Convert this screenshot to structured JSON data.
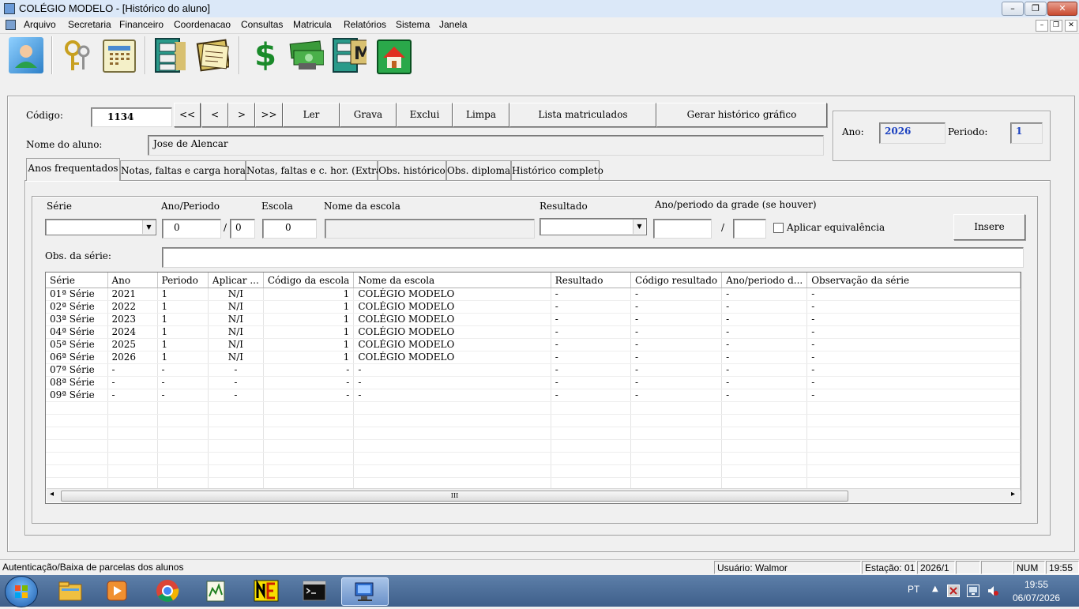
{
  "window": {
    "title": "COLÉGIO MODELO - [Histórico do aluno]",
    "min": "–",
    "max": "❐",
    "close": "✕"
  },
  "mdi": {
    "min": "–",
    "max": "❐",
    "close": "✕"
  },
  "menu": [
    "Arquivo",
    "Secretaria",
    "Financeiro",
    "Coordenacao",
    "Consultas",
    "Matricula",
    "Relatórios",
    "Sistema",
    "Janela"
  ],
  "toolbar": {
    "icons": [
      "user-icon",
      "keys-icon",
      "calendar-icon",
      "file-cabinet-icon",
      "documents-icon",
      "dollar-icon",
      "money-icon",
      "cabinet-m-icon",
      "home-icon"
    ],
    "dollar_glyph": "$",
    "cabinet_letter": "M"
  },
  "form": {
    "codigo_label": "Código:",
    "codigo_value": "1134",
    "nav": [
      "<<",
      "<",
      ">",
      ">>"
    ],
    "actions": [
      "Ler",
      "Grava",
      "Exclui",
      "Limpa",
      "Lista matriculados",
      "Gerar histórico gráfico"
    ],
    "nome_label": "Nome do aluno:",
    "nome_value": "Jose de Alencar",
    "ano_label": "Ano:",
    "ano_value": "2026",
    "periodo_label": "Periodo:",
    "periodo_value": "1"
  },
  "tabs": [
    "Anos frequentados",
    "Notas, faltas e carga horaria",
    "Notas, faltas e c. hor. (Extras)",
    "Obs. histórico",
    "Obs. diploma",
    "Histórico completo"
  ],
  "inputs": {
    "serie_label": "Série",
    "ano_periodo_label": "Ano/Periodo",
    "ano_value": "0",
    "slash": "/",
    "periodo_value": "0",
    "escola_label": "Escola",
    "escola_value": "0",
    "nome_escola_label": "Nome da escola",
    "resultado_label": "Resultado",
    "grade_label": "Ano/periodo da grade (se houver)",
    "aplicar_label": "Aplicar equivalência",
    "insere_label": "Insere",
    "obs_label": "Obs. da série:"
  },
  "grid": {
    "columns": [
      "Série",
      "Ano",
      "Periodo",
      "Aplicar ...",
      "Código da escola",
      "Nome da escola",
      "Resultado",
      "Código resultado",
      "Ano/periodo d...",
      "Observação da série"
    ],
    "rows": [
      [
        "01ª Série",
        "2021",
        "1",
        "N/I",
        "1",
        "COLÉGIO MODELO",
        "-",
        "-",
        "-",
        "-"
      ],
      [
        "02ª Série",
        "2022",
        "1",
        "N/I",
        "1",
        "COLÉGIO MODELO",
        "-",
        "-",
        "-",
        "-"
      ],
      [
        "03ª Série",
        "2023",
        "1",
        "N/I",
        "1",
        "COLÉGIO MODELO",
        "-",
        "-",
        "-",
        "-"
      ],
      [
        "04ª Série",
        "2024",
        "1",
        "N/I",
        "1",
        "COLÉGIO MODELO",
        "-",
        "-",
        "-",
        "-"
      ],
      [
        "05ª Série",
        "2025",
        "1",
        "N/I",
        "1",
        "COLÉGIO MODELO",
        "-",
        "-",
        "-",
        "-"
      ],
      [
        "06ª Série",
        "2026",
        "1",
        "N/I",
        "1",
        "COLÉGIO MODELO",
        "-",
        "-",
        "-",
        "-"
      ],
      [
        "07ª Série",
        "-",
        "-",
        "-",
        "-",
        "-",
        "-",
        "-",
        "-",
        "-"
      ],
      [
        "08ª Série",
        "-",
        "-",
        "-",
        "-",
        "-",
        "-",
        "-",
        "-",
        "-"
      ],
      [
        "09ª Série",
        "-",
        "-",
        "-",
        "-",
        "-",
        "-",
        "-",
        "-",
        "-"
      ]
    ],
    "empty_rows": 7,
    "scroll_grip": "III",
    "scroll_left": "◂",
    "scroll_right": "▸"
  },
  "statusbar": {
    "message": "Autenticação/Baixa de parcelas dos alunos",
    "usuario": "Usuário: Walmor",
    "estacao": "Estação: 01",
    "periodo": "2026/1",
    "num": "NUM",
    "time": "19:55"
  },
  "taskbar": {
    "lang": "PT",
    "time": "19:55",
    "date": "06/07/2026",
    "apps": [
      "explorer-icon",
      "media-player-icon",
      "chrome-icon",
      "editor-icon",
      "nero-icon",
      "cmd-icon",
      "school-app-icon"
    ]
  }
}
